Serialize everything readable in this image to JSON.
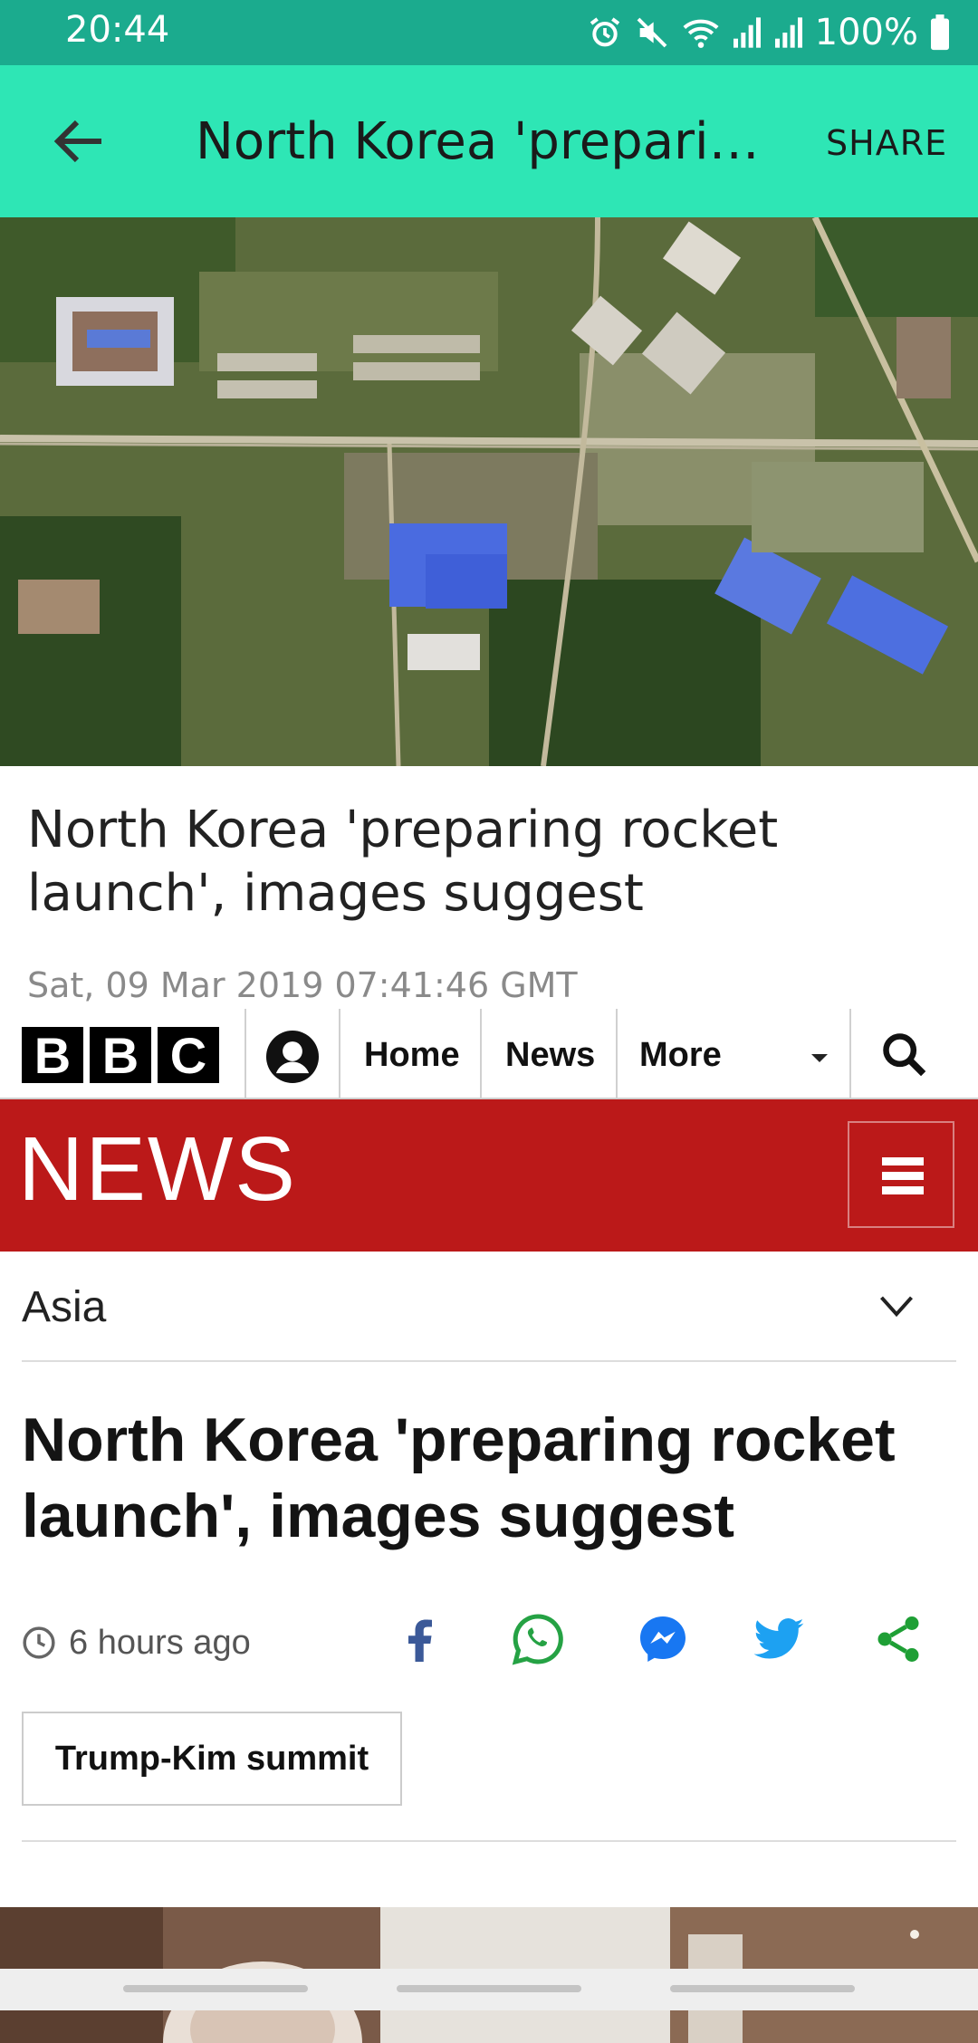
{
  "status_bar": {
    "time": "20:44",
    "battery": "100%",
    "icons": [
      "alarm-icon",
      "mute-icon",
      "wifi-icon",
      "signal-icon",
      "signal-icon",
      "battery-icon"
    ]
  },
  "app_bar": {
    "title": "North Korea 'preparing rocket launch', images suggest",
    "share_label": "SHARE"
  },
  "card": {
    "title": "North Korea 'preparing rocket launch', images suggest",
    "date": "Sat, 09 Mar 2019 07:41:46 GMT"
  },
  "bbc_nav": {
    "logo_letters": [
      "B",
      "B",
      "C"
    ],
    "home": "Home",
    "news": "News",
    "more": "More"
  },
  "news_banner": {
    "label": "NEWS"
  },
  "section": {
    "label": "Asia"
  },
  "article": {
    "title": "North Korea 'preparing rocket launch', images suggest",
    "time": "6 hours ago",
    "tag": "Trump-Kim summit"
  },
  "colors": {
    "status_bar": "#1bab8e",
    "app_bar": "#2ee6b5",
    "bbc_red": "#bb1919"
  }
}
